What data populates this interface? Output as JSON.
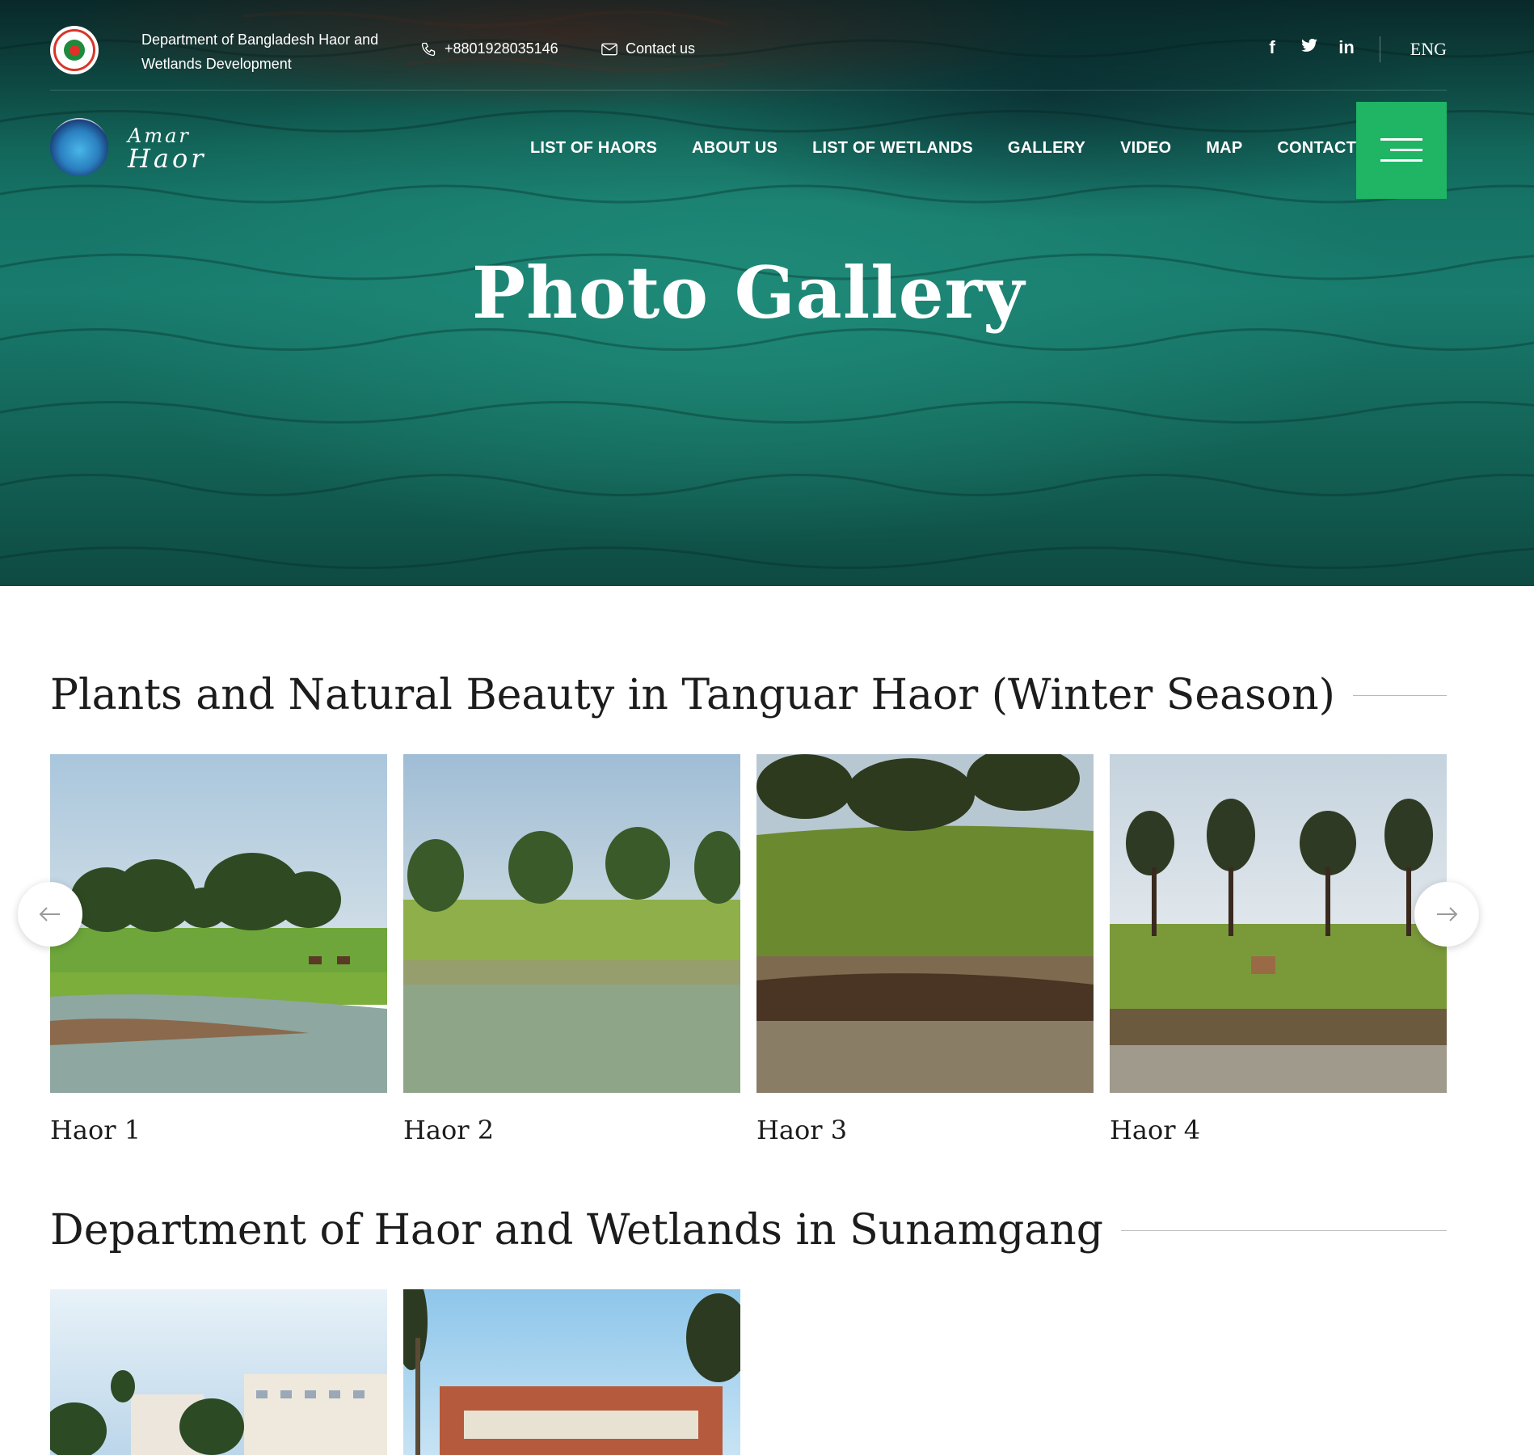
{
  "topbar": {
    "department": "Department of Bangladesh Haor and Wetlands Development",
    "phone": "+8801928035146",
    "contact": "Contact us",
    "socials": [
      "facebook-icon",
      "twitter-icon",
      "linkedin-icon"
    ],
    "language": "ENG"
  },
  "brand": {
    "line1": "Amar",
    "line2": "Haor"
  },
  "nav": {
    "items": [
      "LIST OF HAORS",
      "ABOUT US",
      "LIST OF WETLANDS",
      "GALLERY",
      "VIDEO",
      "MAP",
      "CONTACT US"
    ]
  },
  "hero": {
    "title": "Photo Gallery"
  },
  "sections": [
    {
      "title": "Plants and Natural Beauty in Tanguar Haor (Winter Season)",
      "photos": [
        {
          "caption": "Haor 1"
        },
        {
          "caption": "Haor 2"
        },
        {
          "caption": "Haor 3"
        },
        {
          "caption": "Haor 4"
        }
      ]
    },
    {
      "title": "Department of Haor and Wetlands in Sunamgang"
    }
  ],
  "colors": {
    "accent": "#1fb564",
    "hero_water": "#187b6d",
    "text": "#1c1c1c"
  }
}
